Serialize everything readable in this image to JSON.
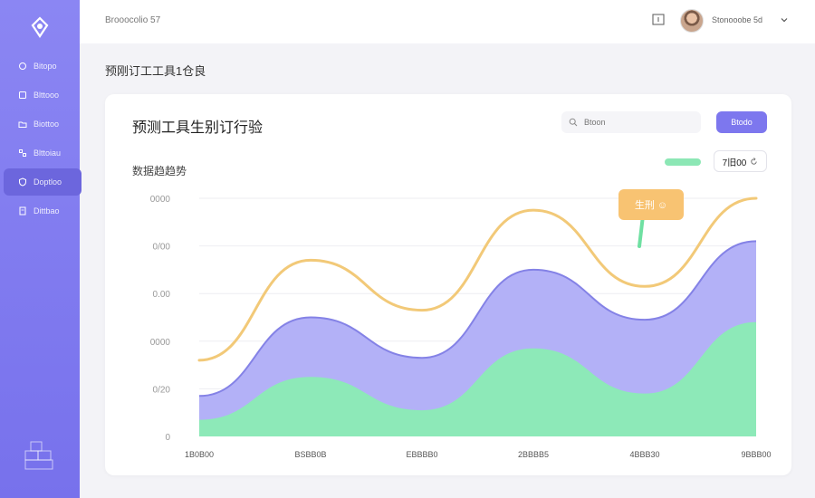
{
  "header": {
    "title": "Brooocolio 57",
    "user_name": "Stonooobe 5d"
  },
  "sidebar": {
    "items": [
      {
        "label": "Bitopo",
        "icon": "home-icon"
      },
      {
        "label": "Blttooo",
        "icon": "chart-icon"
      },
      {
        "label": "Biottoo",
        "icon": "folder-icon"
      },
      {
        "label": "Blttoiau",
        "icon": "grid-icon"
      },
      {
        "label": "Doptloo",
        "icon": "shield-icon",
        "active": true
      },
      {
        "label": "Dittbao",
        "icon": "document-icon"
      }
    ]
  },
  "breadcrumb": "预刚订工工具1仓良",
  "card": {
    "title": "预测工具生别订行验",
    "search_placeholder": "Btoon",
    "primary_button": "Btodo",
    "section_title": "数据趋趋势",
    "range_button": "7旧00"
  },
  "tooltip": {
    "label": "生刑 ☺"
  },
  "colors": {
    "accent": "#7d77ee",
    "line_series": "#f2c978",
    "purple_area": "#b3b1f7",
    "green_area": "#8de9b8",
    "tooltip": "#f8c372"
  },
  "chart_data": {
    "type": "area",
    "x": [
      "1B0B00",
      "BSBB0B",
      "EBBBB0",
      "2BBBB5",
      "4BBB30",
      "9BBB00"
    ],
    "y_ticks": [
      "0000",
      "0/00",
      "0.00",
      "0000",
      "0/20",
      "0"
    ],
    "ylim": [
      0,
      100
    ],
    "series": [
      {
        "name": "",
        "type": "line",
        "values": [
          32,
          74,
          53,
          95,
          63,
          100
        ]
      },
      {
        "name": "",
        "type": "area",
        "values": [
          17,
          50,
          33,
          70,
          49,
          82
        ]
      },
      {
        "name": "",
        "type": "area",
        "values": [
          7,
          25,
          11,
          37,
          18,
          48
        ]
      }
    ]
  }
}
